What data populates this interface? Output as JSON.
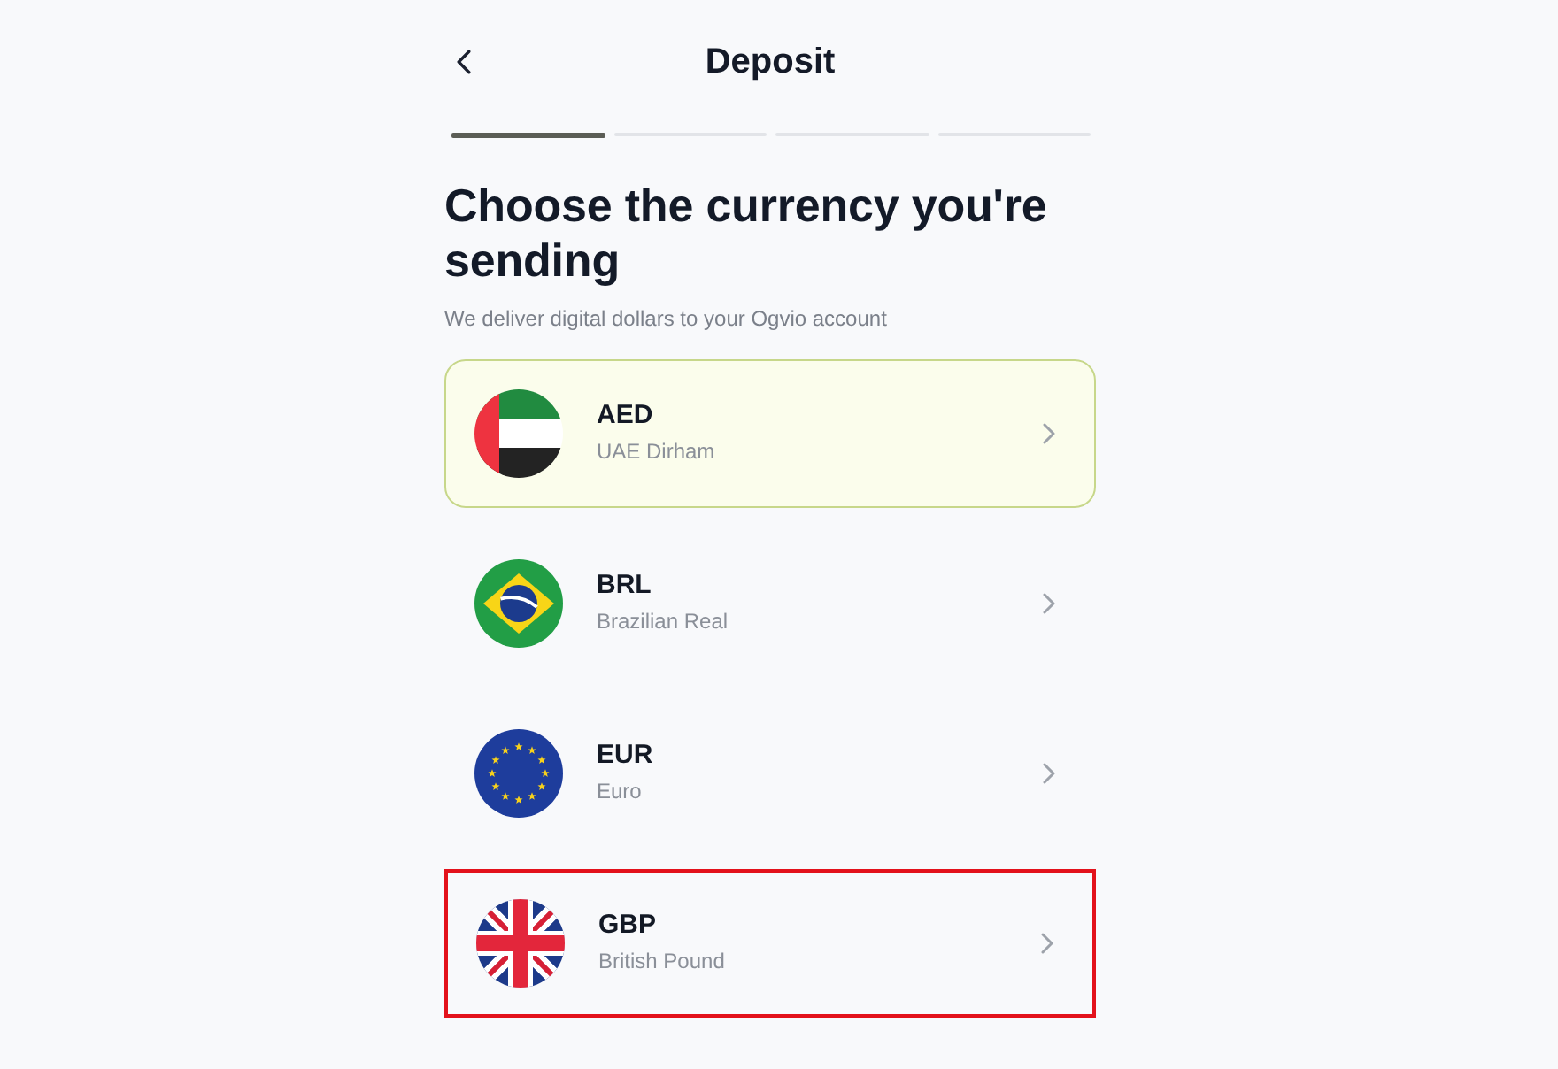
{
  "header": {
    "title": "Deposit"
  },
  "steps": [
    {
      "completed": true
    },
    {
      "completed": false
    },
    {
      "completed": false
    },
    {
      "completed": false
    }
  ],
  "heading": "Choose the currency you're sending",
  "subtitle": "We deliver digital dollars to your Ogvio account",
  "currencies": [
    {
      "code": "AED",
      "name": "UAE Dirham",
      "selected": true,
      "highlighted": false
    },
    {
      "code": "BRL",
      "name": "Brazilian Real",
      "selected": false,
      "highlighted": false
    },
    {
      "code": "EUR",
      "name": "Euro",
      "selected": false,
      "highlighted": false
    },
    {
      "code": "GBP",
      "name": "British Pound",
      "selected": false,
      "highlighted": true
    }
  ]
}
